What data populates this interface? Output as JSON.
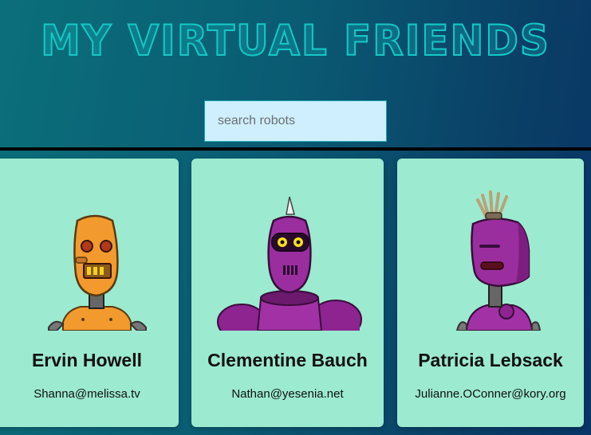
{
  "header": {
    "title": "My Virtual Friends",
    "search_placeholder": "search robots"
  },
  "robots": [
    {
      "name": "Ervin Howell",
      "email": "Shanna@melissa.tv",
      "avatar": "orange-robot-avatar"
    },
    {
      "name": "Clementine Bauch",
      "email": "Nathan@yesenia.net",
      "avatar": "purple-horned-robot-avatar"
    },
    {
      "name": "Patricia Lebsack",
      "email": "Julianne.OConner@kory.org",
      "avatar": "purple-antenna-robot-avatar"
    }
  ],
  "colors": {
    "title": "#14c8c6",
    "card_background": "#9ceacf",
    "search_background": "#cfeefe"
  }
}
